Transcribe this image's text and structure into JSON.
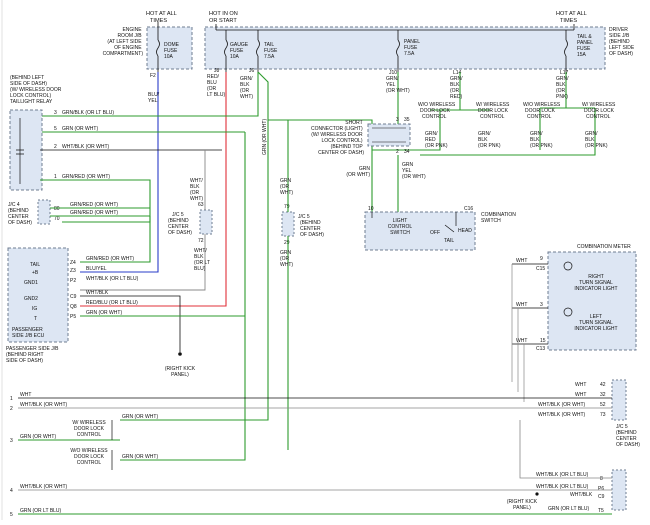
{
  "colors": {
    "red": "#e0303a",
    "blue": "#2a3cc8",
    "green": "#2e9b2e",
    "purple": "#8a3c9a",
    "gray": "#888888",
    "black": "#111111",
    "box_fill": "#dde6f3",
    "box_border": "#6f7d92"
  },
  "power": {
    "hot_all_times_left": [
      "HOT AT ALL",
      "TIMES"
    ],
    "hot_ign": [
      "HOT IN ON",
      "OR START"
    ],
    "hot_all_times_right": [
      "HOT AT ALL",
      "TIMES"
    ],
    "engine_room_jb": [
      "ENGINE",
      "ROOM J/B",
      "(AT LEFT SIDE",
      "OF ENGINE",
      "COMPARTMENT)"
    ],
    "driver_jb": [
      "DRIVER",
      "SIDE J/B",
      "(BEHIND",
      "LEFT SIDE",
      "OF DASH)"
    ]
  },
  "fuses": {
    "dome": [
      "DOME",
      "FUSE",
      "10A"
    ],
    "gauge": [
      "GAUGE",
      "FUSE",
      "10A"
    ],
    "tail": [
      "TAIL",
      "FUSE",
      "7.5A"
    ],
    "panel": [
      "PANEL",
      "FUSE",
      "7.5A"
    ],
    "tail_panel": [
      "TAIL &",
      "PANEL",
      "FUSE",
      "15A"
    ]
  },
  "pins": {
    "f2": "F2",
    "j8": "J8",
    "j6": "J6",
    "j10": "J10",
    "l14": "L14",
    "l17": "L17",
    "p3": "3",
    "p35": "35",
    "p2": "2",
    "p34": "34",
    "p10": "10",
    "c16": "C16",
    "p79": "79",
    "p29": "29",
    "p63": "63",
    "p72": "72",
    "p80": "80",
    "p70": "70",
    "p6": "6",
    "p15": "15",
    "c13": "C13",
    "pin3": "3",
    "p9": "9",
    "c15": "C15",
    "p42": "42",
    "p32": "32",
    "p52": "52",
    "p73": "73",
    "p8": "8",
    "p6b": "P6",
    "c9": "C9",
    "t5": "T5"
  },
  "wire_labels": {
    "blu_yel": [
      "BLU/",
      "YEL"
    ],
    "red_blu": [
      "RED/",
      "BLU",
      "(OR",
      "LT BLU)"
    ],
    "grn_blk": [
      "GRN/",
      "BLK",
      "(OR",
      "WHT)"
    ],
    "grn_wht_v": "GRN (OR WHT)",
    "j10_wire": [
      "GRN/",
      "YEL",
      "(OR WHT)"
    ],
    "l14_wire": [
      "GRN/",
      "BLK",
      "(OR",
      "RED)"
    ],
    "l17_wire": [
      "GRN/",
      "BLK",
      "(OR",
      "PNK)"
    ],
    "w1": "GRN/BLK (OR LT BLU)",
    "w2": "GRN (OR WHT)",
    "w3": "WHT/BLK   (OR WHT)",
    "w4": "GRN/RED (OR WHT)",
    "w80": "GRN/RED (OR WHT)",
    "w70": "GRN/RED (OR WHT)",
    "jc5_63": [
      "WHT/",
      "BLK",
      "(OR",
      "WHT)"
    ],
    "jc5_72": [
      "WHT/",
      "BLK",
      "(OR LT",
      "BLU)"
    ],
    "grn_wht_79": [
      "GRN",
      "(OR",
      "WHT)"
    ],
    "grn_wht_29": [
      "GRN",
      "(OR",
      "WHT)"
    ],
    "sc_left": [
      "GRN",
      "(OR WHT)"
    ],
    "sc_right": [
      "GRN",
      "YEL",
      "(OR WHT)"
    ],
    "sc_b": [
      "GRN/",
      "RED",
      "(OR PNK)"
    ],
    "sc_c": [
      "GRN/",
      "BLK",
      "(OR PNK)"
    ],
    "sc_d": [
      "GRN/",
      "BLK",
      "(OR PNK)"
    ],
    "sc_e": [
      "GRN/",
      "BLK",
      "(OR PNK)"
    ],
    "z4": "GRN/RED (OR WHT)",
    "z3": "BLU/YEL",
    "p2w": "WHT/BLK   (OR LT BLU)",
    "c9w": "WHT/BLK",
    "q8": "RED/BLU   (OR LT BLU)",
    "p5": "GRN (OR WHT)",
    "cm_wht_1": "WHT",
    "cm_wht_2": "WHT",
    "cm_wht_3": "WHT",
    "jc5b_42": "WHT",
    "jc5b_32": "WHT",
    "jc5b_52": "WHT/BLK (OR WHT)",
    "jc5b_73": "WHT/BLK (OR WHT)",
    "jb_a": "WHT/BLK (OR LT BLU)",
    "jb_b": "WHT/BLK (OR LT BLU)",
    "jb_c": "WHT/BLK",
    "jb_d": "GRN (OR LT BLU)",
    "bot_1": "WHT",
    "bot_2": "WHT/BLK (OR WHT)",
    "bot_3": "GRN (OR WHT)",
    "bot_4": "WHT/BLK (OR WHT)",
    "bot_5": "GRN (OR LT BLU)",
    "wl_1": "GRN (OR WHT)",
    "wl_2": "GRN (OR WHT)"
  },
  "components": {
    "taillight_relay": [
      "(BEHIND LEFT",
      "SIDE OF DASH)",
      "(W/ WIRELESS DOOR",
      "LOCK CONTROL)",
      "TAILLIGHT RELAY"
    ],
    "jc4": [
      "J/C 4",
      "(BEHIND",
      "CENTER",
      "OF DASH)"
    ],
    "jc5_a": [
      "J/C 5",
      "(BEHIND",
      "CENTER",
      "OF DASH)"
    ],
    "jc5_b": [
      "J/C 5",
      "(BEHIND",
      "CENTER",
      "OF DASH)"
    ],
    "jc5_c": [
      "J/C 5",
      "(BEHIND",
      "CENTER",
      "OF DASH)"
    ],
    "short_connector": [
      "SHORT",
      "CONNECTOR (LIGHT)",
      "(W/ WIRELESS DOOR",
      "LOCK CONTROL)",
      "(BEHIND TOP",
      "CENTER OF DASH)"
    ],
    "light_switch": [
      "LIGHT",
      "CONTROL",
      "SWITCH"
    ],
    "combination_switch": [
      "COMBINATION",
      "SWITCH"
    ],
    "switch_positions": {
      "off": "OFF",
      "tail": "TAIL",
      "head": "HEAD"
    },
    "door_lock_1": [
      "W/O WIRELESS",
      "DOOR LOCK",
      "CONTROL"
    ],
    "door_lock_2": [
      "W/ WIRELESS",
      "DOOR LOCK",
      "CONTROL"
    ],
    "door_lock_3": [
      "W/O WIRELESS",
      "DOOR LOCK",
      "CONTROL"
    ],
    "door_lock_4": [
      "W/ WIRELESS",
      "DOOR LOCK",
      "CONTROL"
    ],
    "wl_box_1": [
      "W/ WIRELESS",
      "DOOR LOCK",
      "CONTROL"
    ],
    "wl_box_2": [
      "W/O WIRELESS",
      "DOOR LOCK",
      "CONTROL"
    ],
    "passenger_jb": [
      "PASSENGER",
      "SIDE J/B ECU",
      "PASSENGER SIDE J/B",
      "(BEHIND RIGHT",
      "SIDE OF DASH)"
    ],
    "jb_pins": {
      "tail": "TAIL",
      "plusb": "+B",
      "gnd1": "GND1",
      "gnd2": "GND2",
      "ig": "IG",
      "t": "T"
    },
    "jb_numbers": {
      "z4": "Z4",
      "z3": "Z3",
      "p2": "P2",
      "c9": "C9",
      "q8": "Q8",
      "p5": "P5"
    },
    "right_kick": [
      "(RIGHT KICK",
      "PANEL)"
    ],
    "right_kick_2": [
      "(RIGHT KICK",
      "PANEL)"
    ],
    "combination_meter": "COMBINATION METER",
    "right_turn": [
      "RIGHT",
      "TURN SIGNAL",
      "INDICATOR LIGHT"
    ],
    "left_turn": [
      "LEFT",
      "TURN SIGNAL",
      "INDICATOR LIGHT"
    ]
  },
  "left_numbers": [
    "1",
    "2",
    "3",
    "4",
    "5"
  ]
}
